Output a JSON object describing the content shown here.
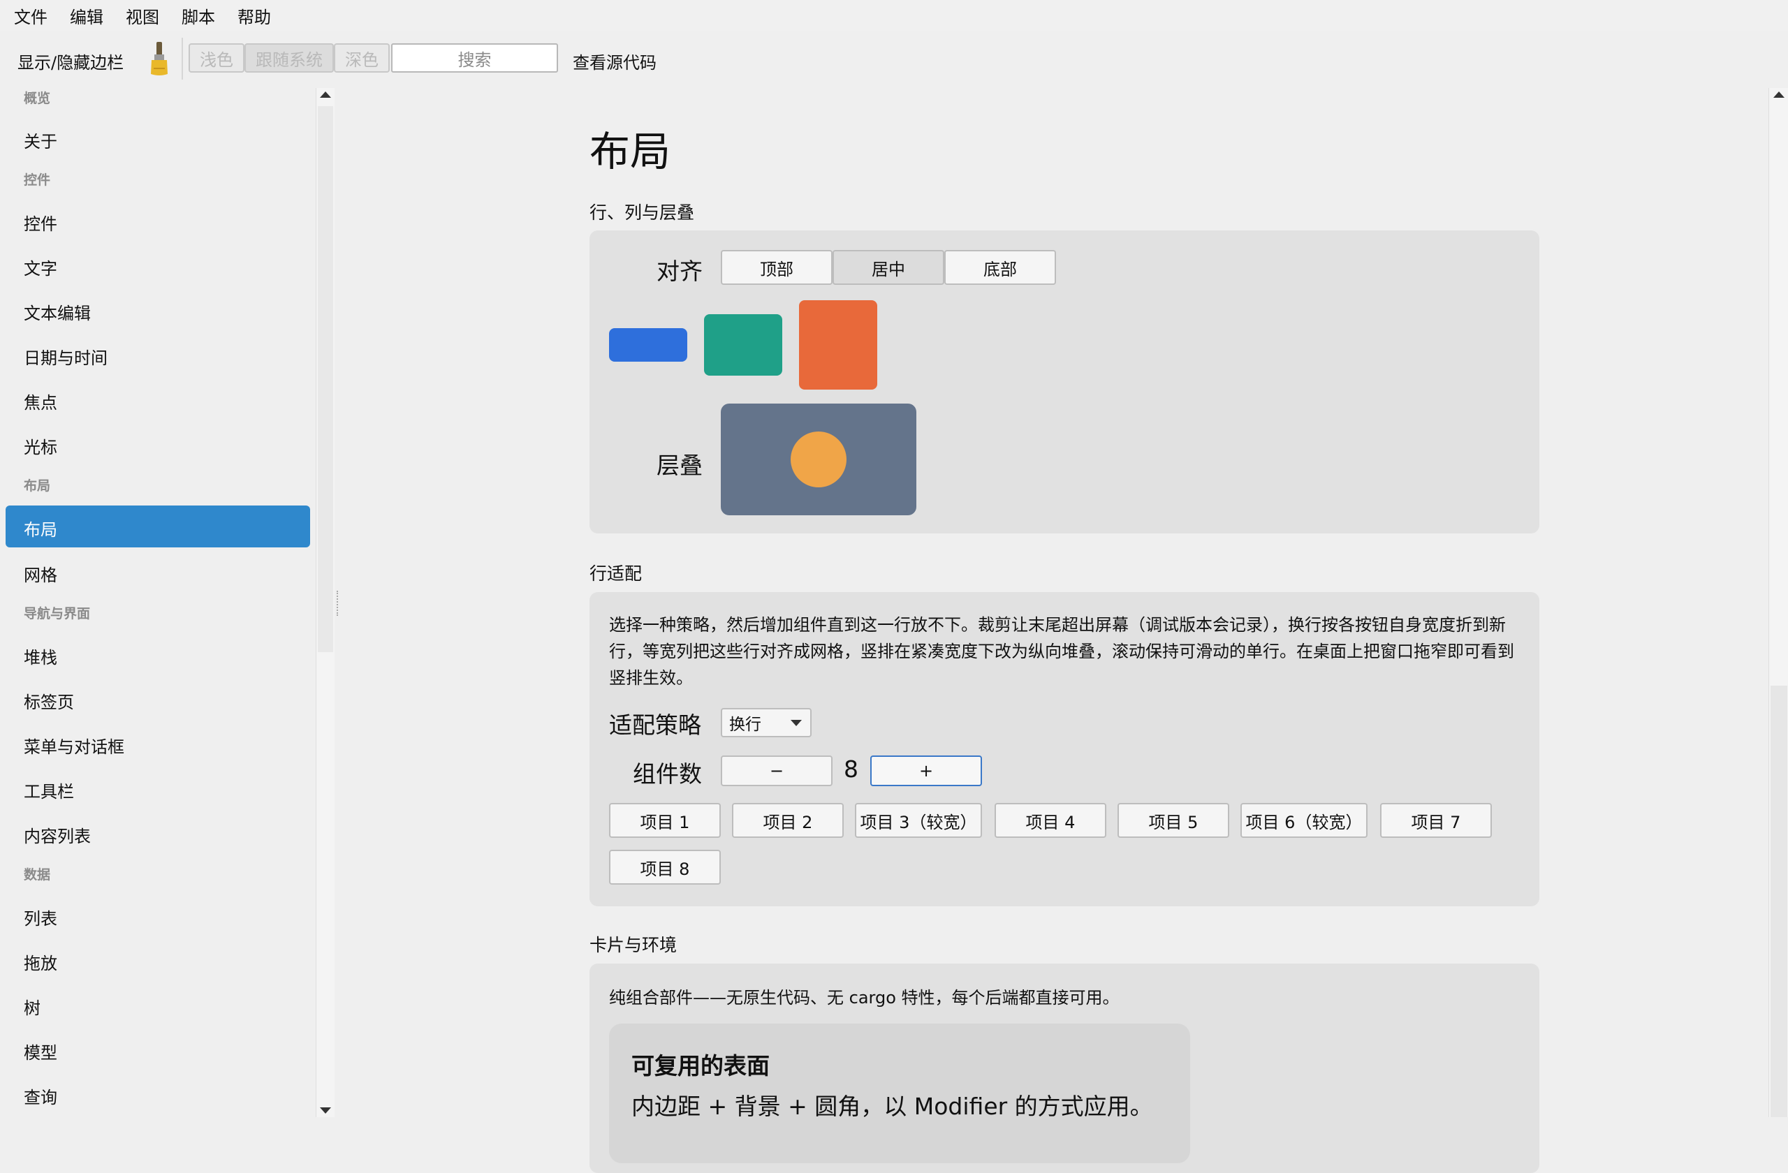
{
  "menubar": [
    "文件",
    "编辑",
    "视图",
    "脚本",
    "帮助"
  ],
  "toolbar": {
    "toggle_sidebar": "显示/隐藏边栏",
    "theme_light": "浅色",
    "theme_system": "跟随系统",
    "theme_dark": "深色",
    "search_placeholder": "搜索",
    "view_source": "查看源代码"
  },
  "sidebar": {
    "sec_overview": "概览",
    "about": "关于",
    "sec_controls": "控件",
    "controls": "控件",
    "text": "文字",
    "text_edit": "文本编辑",
    "datetime": "日期与时间",
    "focus": "焦点",
    "cursor": "光标",
    "sec_layout": "布局",
    "layout": "布局",
    "grid": "网格",
    "sec_nav": "导航与界面",
    "stack": "堆栈",
    "tabs": "标签页",
    "menus": "菜单与对话框",
    "toolbar": "工具栏",
    "content_list": "内容列表",
    "sec_data": "数据",
    "list": "列表",
    "dnd": "拖放",
    "tree": "树",
    "model": "模型",
    "query": "查询"
  },
  "main": {
    "title": "布局",
    "section1": {
      "heading": "行、列与层叠",
      "align_label": "对齐",
      "align_top": "顶部",
      "align_center": "居中",
      "align_bottom": "底部",
      "align_selected": "居中",
      "stack_label": "层叠",
      "colors": {
        "blue": "#2e6fdc",
        "teal": "#1fa088",
        "orange": "#e8693a",
        "slate": "#64748b",
        "amber": "#f0a548"
      }
    },
    "section2": {
      "heading": "行适配",
      "description": "选择一种策略，然后增加组件直到这一行放不下。裁剪让末尾超出屏幕（调试版本会记录），换行按各按钮自身宽度折到新行，等宽列把这些行对齐成网格，竖排在紧凑宽度下改为纵向堆叠，滚动保持可滑动的单行。在桌面上把窗口拖窄即可看到竖排生效。",
      "policy_label": "适配策略",
      "policy_value": "换行",
      "count_label": "组件数",
      "minus": "−",
      "count": "8",
      "plus": "+",
      "items": [
        "项目 1",
        "项目 2",
        "项目 3（较宽）",
        "项目 4",
        "项目 5",
        "项目 6（较宽）",
        "项目 7",
        "项目 8"
      ]
    },
    "section3": {
      "heading": "卡片与环境",
      "description": "纯组合部件——无原生代码、无 cargo 特性，每个后端都直接可用。",
      "card_title": "可复用的表面",
      "card_body": "内边距 + 背景 + 圆角，以 Modifier 的方式应用。"
    }
  }
}
